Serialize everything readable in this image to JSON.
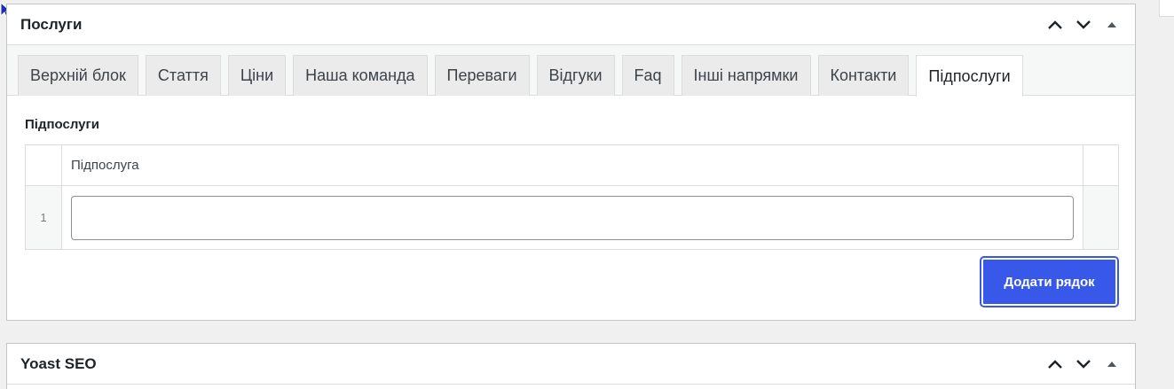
{
  "services_box": {
    "title": "Послуги",
    "tabs": [
      {
        "label": "Верхній блок"
      },
      {
        "label": "Стаття"
      },
      {
        "label": "Ціни"
      },
      {
        "label": "Наша команда"
      },
      {
        "label": "Переваги"
      },
      {
        "label": "Відгуки"
      },
      {
        "label": "Faq"
      },
      {
        "label": "Інші напрямки"
      },
      {
        "label": "Контакти"
      },
      {
        "label": "Підпослуги",
        "active": true
      }
    ],
    "field_label": "Підпослуги",
    "repeater": {
      "column_header": "Підпослуга",
      "rows": [
        {
          "number": "1",
          "value": ""
        }
      ]
    },
    "add_row_label": "Додати рядок"
  },
  "yoast_box": {
    "title": "Yoast SEO"
  },
  "colors": {
    "accent": "#3858e9",
    "background": "#f0f0f1",
    "border": "#c3c4c7"
  }
}
